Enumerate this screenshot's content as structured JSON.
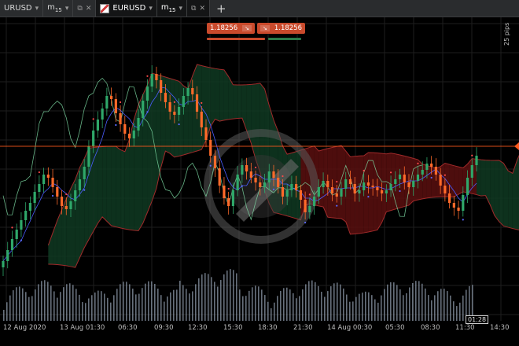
{
  "tabs": [
    {
      "symbol": "URUSD",
      "tf": "m",
      "tf_sub": "15"
    },
    {
      "symbol": "EURUSD",
      "tf": "m",
      "tf_sub": "15",
      "active": true
    }
  ],
  "quote": {
    "sell": "1.18256",
    "buy": "1.18256"
  },
  "pips_label": "25 pips",
  "time_tag": "01:28",
  "x_ticks": [
    "12 Aug 2020",
    "13 Aug 01:30",
    "06:30",
    "09:30",
    "12:30",
    "15:30",
    "18:30",
    "21:30",
    "14 Aug 00:30",
    "05:30",
    "08:30",
    "11:30",
    "14:30"
  ],
  "colors": {
    "up": "#2fa86a",
    "down": "#ff6a2a",
    "price_line": "#ff5a1e",
    "cloud_bear": "#5a0f0f",
    "cloud_bull": "#0f3a22"
  },
  "icons": [
    "chevron-down-icon",
    "popout-icon",
    "close-icon",
    "plus-icon"
  ],
  "chart_data": {
    "type": "candlestick",
    "price_level": 1.18256,
    "close": [
      1.1765,
      1.1772,
      1.1779,
      1.1785,
      1.1791,
      1.1797,
      1.1802,
      1.1809,
      1.1814,
      1.182,
      1.1818,
      1.1812,
      1.1806,
      1.18,
      1.1798,
      1.1803,
      1.181,
      1.1817,
      1.1825,
      1.1838,
      1.1848,
      1.1855,
      1.1862,
      1.187,
      1.1868,
      1.1859,
      1.1852,
      1.1846,
      1.1843,
      1.1848,
      1.1856,
      1.1867,
      1.1876,
      1.1884,
      1.188,
      1.1872,
      1.1866,
      1.186,
      1.1858,
      1.1863,
      1.187,
      1.1875,
      1.1871,
      1.186,
      1.185,
      1.1842,
      1.1832,
      1.1824,
      1.1813,
      1.1805,
      1.18,
      1.181,
      1.182,
      1.1826,
      1.1822,
      1.1818,
      1.1815,
      1.1812,
      1.1815,
      1.1822,
      1.1818,
      1.1812,
      1.1806,
      1.181,
      1.1814,
      1.181,
      1.1804,
      1.1796,
      1.18,
      1.1806,
      1.1812,
      1.1816,
      1.1812,
      1.1808,
      1.1806,
      1.1811,
      1.1817,
      1.1814,
      1.1808,
      1.181,
      1.1815,
      1.1813,
      1.1812,
      1.181,
      1.1808,
      1.181,
      1.1814,
      1.1817,
      1.182,
      1.1815,
      1.1812,
      1.1816,
      1.182,
      1.1823,
      1.1827,
      1.1825,
      1.182,
      1.1813,
      1.1808,
      1.1802,
      1.1799,
      1.1797,
      1.1807,
      1.1818,
      1.1826,
      1.1832
    ]
  }
}
